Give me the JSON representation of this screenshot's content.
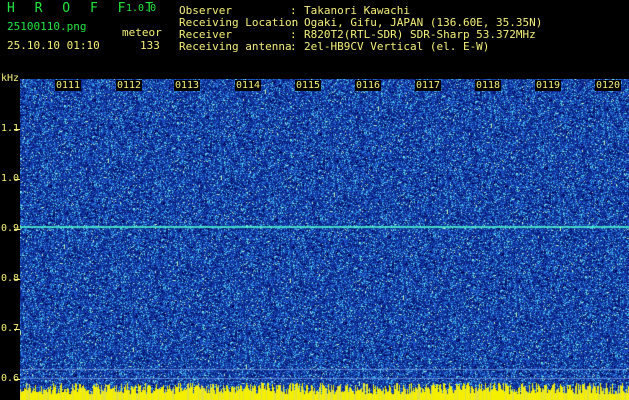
{
  "app": {
    "logo": "H R O F F T",
    "version": "1.0.0"
  },
  "file": {
    "name": "25100110.png",
    "datetime": "25.10.10 01:10"
  },
  "counter": {
    "label": "meteor",
    "count": "133"
  },
  "info": {
    "observer_label": "Observer",
    "observer": "Takanori Kawachi",
    "location_label": "Receiving Location",
    "location": "Ogaki, Gifu, JAPAN (136.60E, 35.35N)",
    "receiver_label": "Receiver",
    "receiver": "R820T2(RTL-SDR) SDR-Sharp 53.372MHz",
    "antenna_label": "Receiving antenna",
    "antenna": "2el-HB9CV Vertical (el. E-W)"
  },
  "axis": {
    "unit": "kHz",
    "y_ticks": [
      "1.1",
      "1.0",
      "0.9",
      "0.8",
      "0.7",
      "0.6"
    ],
    "x_ticks": [
      "0111",
      "0112",
      "0113",
      "0114",
      "0115",
      "0116",
      "0117",
      "0118",
      "0119",
      "0120"
    ]
  },
  "colors": {
    "background": "#0c2a8c",
    "label": "#f5f07a",
    "title": "#22e640",
    "carrier": "#4dffd0"
  }
}
